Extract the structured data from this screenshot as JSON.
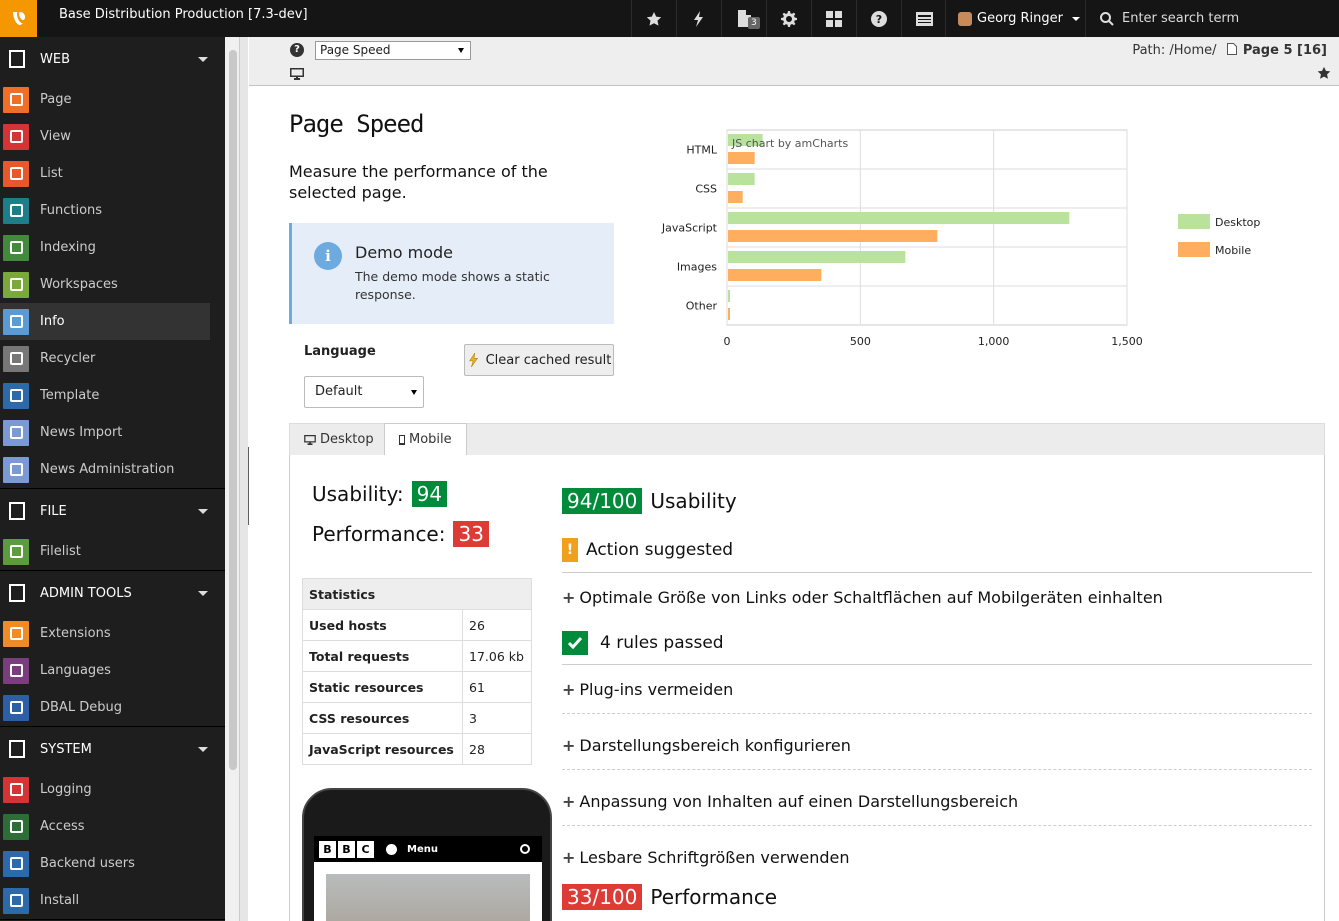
{
  "topbar": {
    "site_name": "Base Distribution Production [7.3-dev]",
    "opendocs_count": "3",
    "user_name": "Georg Ringer",
    "search_placeholder": "Enter search term"
  },
  "sidebar": {
    "groups": [
      {
        "label": "WEB",
        "items": [
          {
            "label": "Page",
            "icon": "page-icon",
            "color": "#f06e26"
          },
          {
            "label": "View",
            "icon": "eye-icon",
            "color": "#d53437"
          },
          {
            "label": "List",
            "icon": "list-icon",
            "color": "#e9582d"
          },
          {
            "label": "Functions",
            "icon": "wand-icon",
            "color": "#1d7d8a"
          },
          {
            "label": "Indexing",
            "icon": "chart-icon",
            "color": "#448a3d"
          },
          {
            "label": "Workspaces",
            "icon": "workspaces-icon",
            "color": "#79a93b"
          },
          {
            "label": "Info",
            "icon": "info-icon",
            "color": "#5b9bd5"
          },
          {
            "label": "Recycler",
            "icon": "trash-icon",
            "color": "#777777"
          },
          {
            "label": "Template",
            "icon": "template-icon",
            "color": "#2c6aa9"
          },
          {
            "label": "News Import",
            "icon": "news-icon",
            "color": "#7b9ad4"
          },
          {
            "label": "News Administration",
            "icon": "news-icon",
            "color": "#7b9ad4"
          }
        ]
      },
      {
        "label": "FILE",
        "items": [
          {
            "label": "Filelist",
            "icon": "cloud-icon",
            "color": "#5d9c3e"
          }
        ]
      },
      {
        "label": "ADMIN TOOLS",
        "items": [
          {
            "label": "Extensions",
            "icon": "puzzle-icon",
            "color": "#f08b25"
          },
          {
            "label": "Languages",
            "icon": "globe-icon",
            "color": "#7a3d7e"
          },
          {
            "label": "DBAL Debug",
            "icon": "database-icon",
            "color": "#2d5fa6"
          }
        ]
      },
      {
        "label": "SYSTEM",
        "items": [
          {
            "label": "Logging",
            "icon": "log-icon",
            "color": "#d53437"
          },
          {
            "label": "Access",
            "icon": "lock-icon",
            "color": "#2d6e36"
          },
          {
            "label": "Backend users",
            "icon": "user-icon",
            "color": "#2c6aa9"
          },
          {
            "label": "Install",
            "icon": "typo3-icon",
            "color": "#2c6aa9"
          }
        ]
      }
    ],
    "active_item": "Info"
  },
  "docheader": {
    "module_select": "Page Speed",
    "path_label": "Path: /Home/",
    "page_label": "Page 5 [16]"
  },
  "main": {
    "title": "Page Speed",
    "description": "Measure the performance of the selected page.",
    "demo": {
      "title": "Demo mode",
      "text": "The demo mode shows a static response."
    },
    "language_label": "Language",
    "language_value": "Default",
    "clear_button": "Clear cached result",
    "tabs": [
      {
        "label": "Desktop"
      },
      {
        "label": "Mobile"
      }
    ],
    "active_tab": "Mobile",
    "usability_label": "Usability:",
    "usability_value": "94",
    "performance_label": "Performance:",
    "performance_value": "33",
    "stats": {
      "header": "Statistics",
      "rows": [
        {
          "label": "Used hosts",
          "value": "26"
        },
        {
          "label": "Total requests",
          "value": "17.06 kb"
        },
        {
          "label": "Static resources",
          "value": "61"
        },
        {
          "label": "CSS resources",
          "value": "3"
        },
        {
          "label": "JavaScript resources",
          "value": "28"
        }
      ]
    },
    "phone": {
      "bbc_letters": [
        "B",
        "B",
        "C"
      ],
      "menu_label": "Menu"
    },
    "results": {
      "usability_badge": "94/100",
      "usability_title": "Usability",
      "action_title": "Action suggested",
      "action_rule": "Optimale Größe von Links oder Schaltflächen auf Mobilgeräten einhalten",
      "passed_title": "4 rules passed",
      "passed_rules": [
        "Plug-ins vermeiden",
        "Darstellungsbereich konfigurieren",
        "Anpassung von Inhalten auf einen Darstellungsbereich",
        "Lesbare Schriftgrößen verwenden"
      ],
      "performance_badge": "33/100",
      "performance_title": "Performance"
    }
  },
  "chart_data": {
    "type": "bar",
    "orientation": "horizontal",
    "categories": [
      "HTML",
      "CSS",
      "JavaScript",
      "Images",
      "Other"
    ],
    "series": [
      {
        "name": "Desktop",
        "color": "#b9e29c",
        "values": [
          130,
          100,
          1280,
          665,
          5
        ]
      },
      {
        "name": "Mobile",
        "color": "#ffad5e",
        "values": [
          100,
          55,
          785,
          350,
          5
        ]
      }
    ],
    "xlim": [
      0,
      1500
    ],
    "xticks": [
      "0",
      "500",
      "1,000",
      "1,500"
    ],
    "watermark": "JS chart by amCharts",
    "legend_position": "right",
    "grid": true
  }
}
